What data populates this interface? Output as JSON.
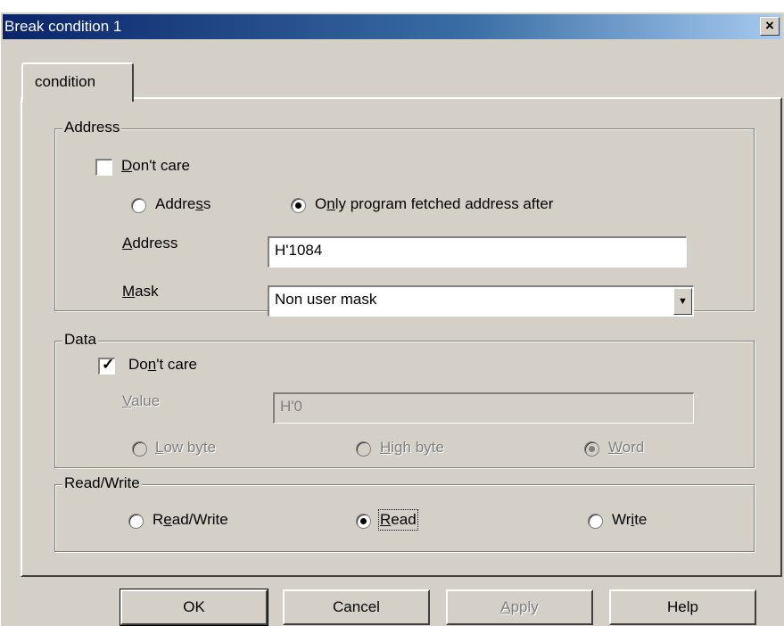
{
  "window": {
    "title": "Break condition 1",
    "close_label": "×"
  },
  "tabs": [
    {
      "label": "condition",
      "selected": true
    }
  ],
  "address_group": {
    "legend": "Address",
    "dont_care": {
      "label_pre": "",
      "mnemonic": "D",
      "label_post": "on't care",
      "checked": false
    },
    "mode_address": {
      "label_pre": "Addre",
      "mnemonic": "s",
      "label_post": "s",
      "selected": false
    },
    "mode_program_fetched": {
      "label_pre": "O",
      "mnemonic": "n",
      "label_post": "ly program fetched address after",
      "selected": true
    },
    "address_label": {
      "label_pre": "",
      "mnemonic": "A",
      "label_post": "ddress"
    },
    "address_value": "H'1084",
    "mask_label": {
      "label_pre": "",
      "mnemonic": "M",
      "label_post": "ask"
    },
    "mask_value": "Non user mask"
  },
  "data_group": {
    "legend": "Data",
    "dont_care": {
      "label_pre": "Do",
      "mnemonic": "n",
      "label_post": "'t care",
      "checked": true
    },
    "value_label": {
      "label_pre": "",
      "mnemonic": "V",
      "label_post": "alue"
    },
    "value_value": "H'0",
    "low_byte": {
      "label_pre": "",
      "mnemonic": "L",
      "label_post": "ow byte",
      "selected": false
    },
    "high_byte": {
      "label_pre": "",
      "mnemonic": "H",
      "label_post": "igh byte",
      "selected": false
    },
    "word": {
      "label_pre": "",
      "mnemonic": "W",
      "label_post": "ord",
      "selected": true
    }
  },
  "rw_group": {
    "legend": "Read/Write",
    "read_write": {
      "label_pre": "R",
      "mnemonic": "e",
      "label_post": "ad/Write",
      "selected": false
    },
    "read": {
      "label_pre": "",
      "mnemonic": "R",
      "label_post": "ead",
      "selected": true
    },
    "write": {
      "label_pre": "Wr",
      "mnemonic": "i",
      "label_post": "te",
      "selected": false
    }
  },
  "buttons": {
    "ok": "OK",
    "cancel": "Cancel",
    "apply": {
      "label_pre": "",
      "mnemonic": "A",
      "label_post": "pply"
    },
    "help": "Help"
  },
  "colors": {
    "face": "#d4d0c8",
    "title_start": "#0a246a",
    "title_end": "#a6caf0",
    "disabled_text": "#808080"
  },
  "icons": {
    "close": "close-icon",
    "dropdown": "chevron-down-icon"
  }
}
